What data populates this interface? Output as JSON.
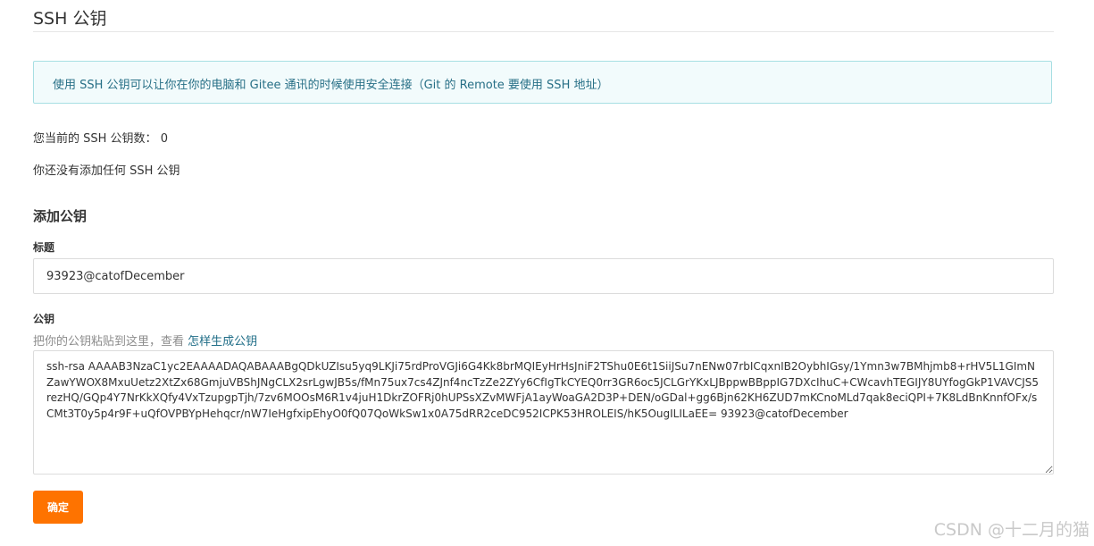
{
  "page": {
    "title": "SSH 公钥"
  },
  "info": {
    "text": "使用 SSH 公钥可以让你在你的电脑和 Gitee 通讯的时候使用安全连接（Git 的 Remote 要使用 SSH 地址）"
  },
  "status": {
    "count_label": "您当前的 SSH 公钥数：",
    "count_value": "0",
    "empty_text": "你还没有添加任何 SSH 公钥"
  },
  "form": {
    "section_title": "添加公钥",
    "title_label": "标题",
    "title_value": "93923@catofDecember",
    "key_label": "公钥",
    "help_text": "把你的公钥粘贴到这里，查看 ",
    "help_link": "怎样生成公钥",
    "key_value": "ssh-rsa AAAAB3NzaC1yc2EAAAADAQABAAABgQDkUZIsu5yq9LKJi75rdProVGJi6G4Kk8brMQIEyHrHsJniF2TShu0E6t1SiiJSu7nENw07rbICqxnIB2OybhIGsy/1Ymn3w7BMhjmb8+rHV5L1GImNZawYWOX8MxuUetz2XtZx68GmjuVBShJNgCLX2srLgwJB5s/fMn75ux7cs4ZJnf4ncTzZe2ZYy6CfIgTkCYEQ0rr3GR6oc5JCLGrYKxLJBppwBBppIG7DXcIhuC+CWcavhTEGIJY8UYfogGkP1VAVCJS5rezHQ/GQp4Y7NrKkXQfy4VxTzupgpTjh/7zv6MOOsM6R1v4juH1DkrZOFRj0hUPSsXZvMWFjA1ayWoaGA2D3P+DEN/oGDal+gg6Bjn62KH6ZUD7mKCnoMLd7qak8eciQPI+7K8LdBnKnnfOFx/sCMt3T0y5p4r9F+uQfOVPBYpHehqcr/nW7IeHgfxipEhyO0fQ07QoWkSw1x0A75dRR2ceDC952ICPK53HROLEIS/hK5OugILILaEE= 93923@catofDecember",
    "submit_label": "确定"
  },
  "watermark": {
    "text": "CSDN @十二月的猫"
  },
  "colors": {
    "accent": "#fe7300",
    "info_bg": "#f2fbfc",
    "info_border": "#a7dfe3",
    "info_text": "#276f86",
    "link": "#1f6d87"
  }
}
